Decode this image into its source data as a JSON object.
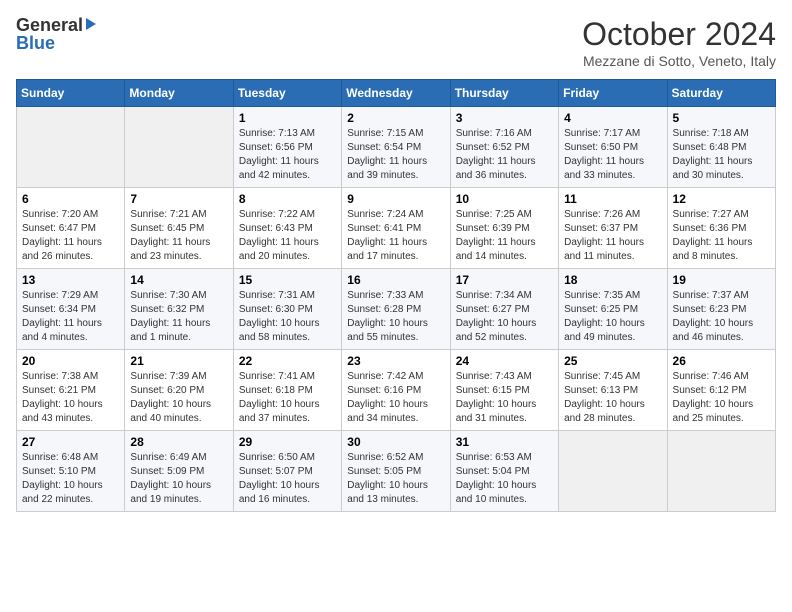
{
  "header": {
    "logo_general": "General",
    "logo_blue": "Blue",
    "title": "October 2024",
    "location": "Mezzane di Sotto, Veneto, Italy"
  },
  "weekdays": [
    "Sunday",
    "Monday",
    "Tuesday",
    "Wednesday",
    "Thursday",
    "Friday",
    "Saturday"
  ],
  "weeks": [
    [
      {
        "day": "",
        "info": ""
      },
      {
        "day": "",
        "info": ""
      },
      {
        "day": "1",
        "info": "Sunrise: 7:13 AM\nSunset: 6:56 PM\nDaylight: 11 hours and 42 minutes."
      },
      {
        "day": "2",
        "info": "Sunrise: 7:15 AM\nSunset: 6:54 PM\nDaylight: 11 hours and 39 minutes."
      },
      {
        "day": "3",
        "info": "Sunrise: 7:16 AM\nSunset: 6:52 PM\nDaylight: 11 hours and 36 minutes."
      },
      {
        "day": "4",
        "info": "Sunrise: 7:17 AM\nSunset: 6:50 PM\nDaylight: 11 hours and 33 minutes."
      },
      {
        "day": "5",
        "info": "Sunrise: 7:18 AM\nSunset: 6:48 PM\nDaylight: 11 hours and 30 minutes."
      }
    ],
    [
      {
        "day": "6",
        "info": "Sunrise: 7:20 AM\nSunset: 6:47 PM\nDaylight: 11 hours and 26 minutes."
      },
      {
        "day": "7",
        "info": "Sunrise: 7:21 AM\nSunset: 6:45 PM\nDaylight: 11 hours and 23 minutes."
      },
      {
        "day": "8",
        "info": "Sunrise: 7:22 AM\nSunset: 6:43 PM\nDaylight: 11 hours and 20 minutes."
      },
      {
        "day": "9",
        "info": "Sunrise: 7:24 AM\nSunset: 6:41 PM\nDaylight: 11 hours and 17 minutes."
      },
      {
        "day": "10",
        "info": "Sunrise: 7:25 AM\nSunset: 6:39 PM\nDaylight: 11 hours and 14 minutes."
      },
      {
        "day": "11",
        "info": "Sunrise: 7:26 AM\nSunset: 6:37 PM\nDaylight: 11 hours and 11 minutes."
      },
      {
        "day": "12",
        "info": "Sunrise: 7:27 AM\nSunset: 6:36 PM\nDaylight: 11 hours and 8 minutes."
      }
    ],
    [
      {
        "day": "13",
        "info": "Sunrise: 7:29 AM\nSunset: 6:34 PM\nDaylight: 11 hours and 4 minutes."
      },
      {
        "day": "14",
        "info": "Sunrise: 7:30 AM\nSunset: 6:32 PM\nDaylight: 11 hours and 1 minute."
      },
      {
        "day": "15",
        "info": "Sunrise: 7:31 AM\nSunset: 6:30 PM\nDaylight: 10 hours and 58 minutes."
      },
      {
        "day": "16",
        "info": "Sunrise: 7:33 AM\nSunset: 6:28 PM\nDaylight: 10 hours and 55 minutes."
      },
      {
        "day": "17",
        "info": "Sunrise: 7:34 AM\nSunset: 6:27 PM\nDaylight: 10 hours and 52 minutes."
      },
      {
        "day": "18",
        "info": "Sunrise: 7:35 AM\nSunset: 6:25 PM\nDaylight: 10 hours and 49 minutes."
      },
      {
        "day": "19",
        "info": "Sunrise: 7:37 AM\nSunset: 6:23 PM\nDaylight: 10 hours and 46 minutes."
      }
    ],
    [
      {
        "day": "20",
        "info": "Sunrise: 7:38 AM\nSunset: 6:21 PM\nDaylight: 10 hours and 43 minutes."
      },
      {
        "day": "21",
        "info": "Sunrise: 7:39 AM\nSunset: 6:20 PM\nDaylight: 10 hours and 40 minutes."
      },
      {
        "day": "22",
        "info": "Sunrise: 7:41 AM\nSunset: 6:18 PM\nDaylight: 10 hours and 37 minutes."
      },
      {
        "day": "23",
        "info": "Sunrise: 7:42 AM\nSunset: 6:16 PM\nDaylight: 10 hours and 34 minutes."
      },
      {
        "day": "24",
        "info": "Sunrise: 7:43 AM\nSunset: 6:15 PM\nDaylight: 10 hours and 31 minutes."
      },
      {
        "day": "25",
        "info": "Sunrise: 7:45 AM\nSunset: 6:13 PM\nDaylight: 10 hours and 28 minutes."
      },
      {
        "day": "26",
        "info": "Sunrise: 7:46 AM\nSunset: 6:12 PM\nDaylight: 10 hours and 25 minutes."
      }
    ],
    [
      {
        "day": "27",
        "info": "Sunrise: 6:48 AM\nSunset: 5:10 PM\nDaylight: 10 hours and 22 minutes."
      },
      {
        "day": "28",
        "info": "Sunrise: 6:49 AM\nSunset: 5:09 PM\nDaylight: 10 hours and 19 minutes."
      },
      {
        "day": "29",
        "info": "Sunrise: 6:50 AM\nSunset: 5:07 PM\nDaylight: 10 hours and 16 minutes."
      },
      {
        "day": "30",
        "info": "Sunrise: 6:52 AM\nSunset: 5:05 PM\nDaylight: 10 hours and 13 minutes."
      },
      {
        "day": "31",
        "info": "Sunrise: 6:53 AM\nSunset: 5:04 PM\nDaylight: 10 hours and 10 minutes."
      },
      {
        "day": "",
        "info": ""
      },
      {
        "day": "",
        "info": ""
      }
    ]
  ]
}
